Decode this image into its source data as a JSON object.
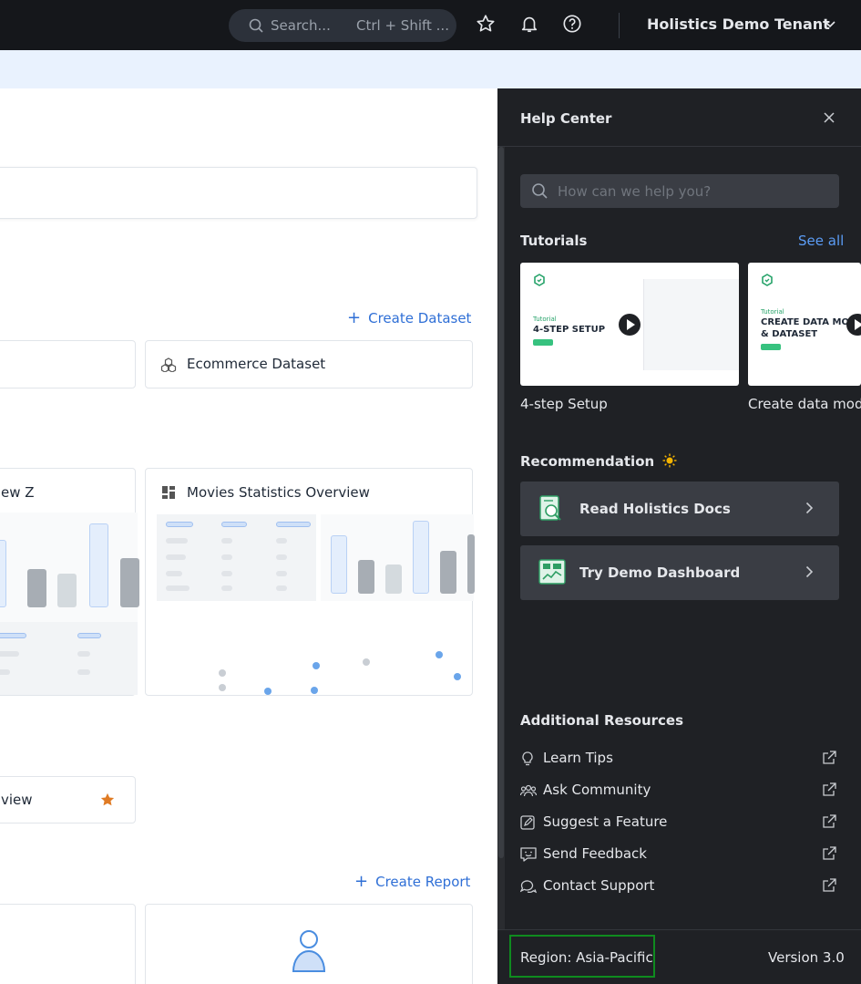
{
  "topbar": {
    "search_placeholder": "Search...",
    "search_shortcut": "Ctrl + Shift ...",
    "tenant_name": "Holistics Demo Tenant"
  },
  "main": {
    "create_dataset": "Create Dataset",
    "dataset_card": "Ecommerce Dataset",
    "dashboard_cut_label": "ew Z",
    "dashboard_card": "Movies Statistics Overview",
    "favorite_cut_label": "view",
    "create_report": "Create Report"
  },
  "help": {
    "title": "Help Center",
    "search_placeholder": "How can we help you?",
    "tutorials_title": "Tutorials",
    "see_all": "See all",
    "tutorials": [
      {
        "tag": "Tutorial",
        "heading": "4-STEP SETUP",
        "caption": "4-step Setup"
      },
      {
        "tag": "Tutorial",
        "heading_line1": "CREATE DATA MOD",
        "heading_line2": "& DATASET",
        "caption": "Create data mode"
      }
    ],
    "recommendation_title": "Recommendation",
    "recommendations": [
      {
        "label": "Read Holistics Docs"
      },
      {
        "label": "Try Demo Dashboard"
      }
    ],
    "resources_title": "Additional Resources",
    "resources": [
      {
        "label": "Learn Tips",
        "icon": "bulb-icon"
      },
      {
        "label": "Ask Community",
        "icon": "community-icon"
      },
      {
        "label": "Suggest a Feature",
        "icon": "edit-icon"
      },
      {
        "label": "Send Feedback",
        "icon": "feedback-icon"
      },
      {
        "label": "Contact Support",
        "icon": "chat-icon"
      }
    ],
    "region": "Region: Asia-Pacific",
    "version": "Version 3.0"
  },
  "colors": {
    "topbar": "#15171b",
    "panel": "#1f2125",
    "accent_link": "#2f6fd6",
    "region_border": "#0f8b1f",
    "star": "#e07b24"
  }
}
